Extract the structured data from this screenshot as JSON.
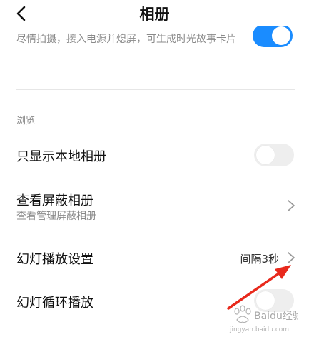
{
  "header": {
    "title": "相册",
    "back_icon": "chevron-left-icon"
  },
  "top_partial_row": {
    "description": "尽情拍摄，接入电源并熄屏，可生成时光故事卡片",
    "toggle_on": true
  },
  "section": {
    "label": "浏览"
  },
  "rows": [
    {
      "title": "只显示本地相册",
      "toggle_on": false
    },
    {
      "title": "查看屏蔽相册",
      "subtitle": "查看管理屏蔽相册"
    },
    {
      "title": "幻灯播放设置",
      "value": "间隔3秒"
    },
    {
      "title": "幻灯循环播放",
      "toggle_on": false
    }
  ],
  "watermark": {
    "brand": "Baidu经验",
    "url": "jingyan.baidu.com"
  },
  "colors": {
    "accent": "#1a8cff",
    "annotation": "#e8291c"
  }
}
